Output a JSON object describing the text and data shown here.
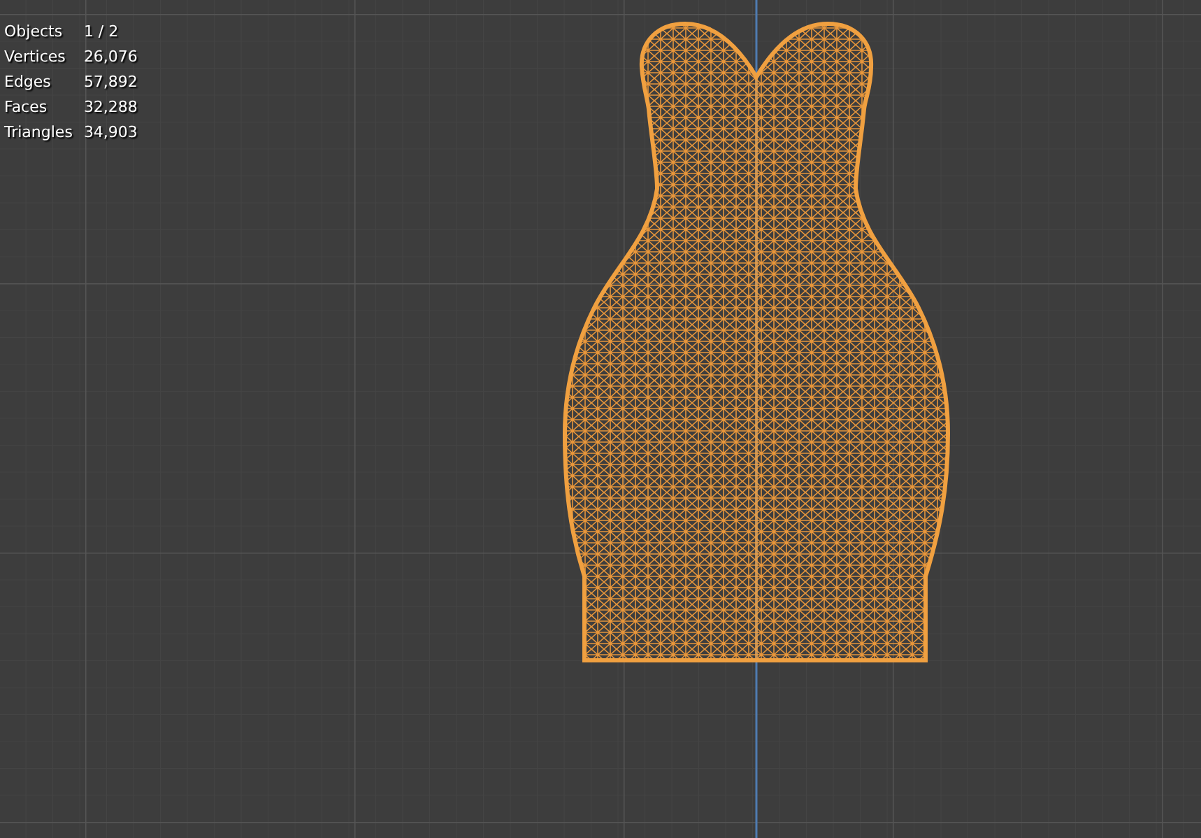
{
  "stats": [
    {
      "label": "Objects",
      "value": "1 / 2"
    },
    {
      "label": "Vertices",
      "value": "26,076"
    },
    {
      "label": "Edges",
      "value": "57,892"
    },
    {
      "label": "Faces",
      "value": "32,288"
    },
    {
      "label": "Triangles",
      "value": "34,903"
    }
  ]
}
